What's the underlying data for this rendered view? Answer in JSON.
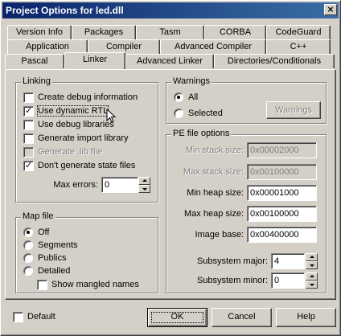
{
  "window": {
    "title": "Project Options for led.dll",
    "close_glyph": "×"
  },
  "tabs": {
    "row1": [
      "Version Info",
      "Packages",
      "Tasm",
      "CORBA",
      "CodeGuard"
    ],
    "row2": [
      "Application",
      "Compiler",
      "Advanced Compiler",
      "C++"
    ],
    "row3": [
      "Pascal",
      "Linker",
      "Advanced Linker",
      "Directories/Conditionals"
    ],
    "active": "Linker"
  },
  "linking": {
    "label": "Linking",
    "create_debug": "Create debug information",
    "use_dynamic_rtl": "Use dynamic RTL",
    "use_debug_libraries": "Use debug libraries",
    "generate_import_library": "Generate import library",
    "generate_lib_file": "Generate .lib file",
    "dont_generate_state": "Don't generate state files",
    "max_errors_label": "Max errors:",
    "max_errors_value": "0",
    "check_glyph": "✓"
  },
  "map_file": {
    "label": "Map file",
    "off": "Off",
    "segments": "Segments",
    "publics": "Publics",
    "detailed": "Detailed",
    "show_mangled": "Show mangled names"
  },
  "warnings": {
    "label": "Warnings",
    "all": "All",
    "selected": "Selected",
    "button": "Warnings"
  },
  "pe_options": {
    "label": "PE file options",
    "min_stack_label": "Min stack size:",
    "min_stack_value": "0x00002000",
    "max_stack_label": "Max stack size:",
    "max_stack_value": "0x00100000",
    "min_heap_label": "Min heap size:",
    "min_heap_value": "0x00001000",
    "max_heap_label": "Max heap size:",
    "max_heap_value": "0x00100000",
    "image_base_label": "Image base:",
    "image_base_value": "0x00400000",
    "subsystem_major_label": "Subsystem major:",
    "subsystem_major_value": "4",
    "subsystem_minor_label": "Subsystem minor:",
    "subsystem_minor_value": "0"
  },
  "footer": {
    "default_label": "Default",
    "ok": "OK",
    "cancel": "Cancel",
    "help": "Help"
  },
  "colors": {
    "face": "#d4d0c8",
    "title_start": "#0a246a",
    "title_end": "#3a6ea5"
  }
}
